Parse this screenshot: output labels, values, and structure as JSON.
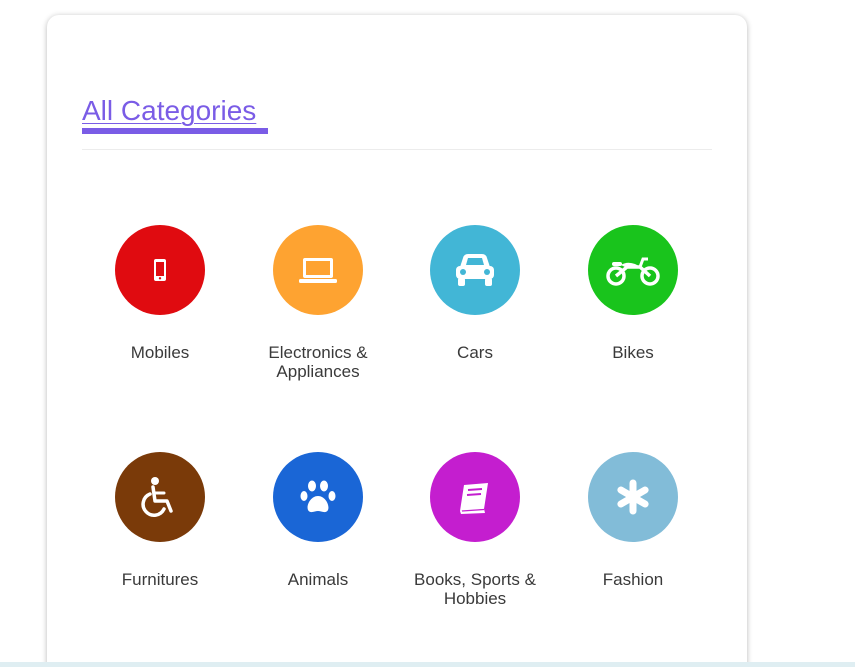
{
  "heading": "All Categories",
  "categories": [
    {
      "label": "Mobiles",
      "icon": "mobile-phone-icon",
      "color": "#e00b10"
    },
    {
      "label": "Electronics & Appliances",
      "icon": "laptop-icon",
      "color": "#fea331"
    },
    {
      "label": "Cars",
      "icon": "car-icon",
      "color": "#42b6d6"
    },
    {
      "label": "Bikes",
      "icon": "motorcycle-icon",
      "color": "#19c41c"
    },
    {
      "label": "Furnitures",
      "icon": "wheelchair-icon",
      "color": "#7a3a09"
    },
    {
      "label": "Animals",
      "icon": "paw-icon",
      "color": "#1a66d6"
    },
    {
      "label": "Books, Sports & Hobbies",
      "icon": "book-icon",
      "color": "#c41ecf"
    },
    {
      "label": "Fashion",
      "icon": "asterisk-icon",
      "color": "#82bcd8"
    }
  ],
  "colors": {
    "accent": "#7a5ce6",
    "text": "#3a3a3a"
  }
}
